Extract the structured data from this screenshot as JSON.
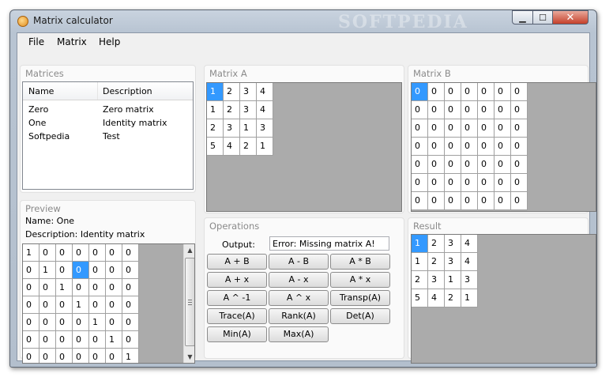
{
  "window": {
    "title": "Matrix calculator",
    "watermark": "SOFTPEDIA",
    "min_glyph": "▁",
    "max_glyph": "☐",
    "close_glyph": "✕",
    "app_icon": "calculator-icon"
  },
  "menu": {
    "items": [
      {
        "label": "File"
      },
      {
        "label": "Matrix"
      },
      {
        "label": "Help"
      }
    ]
  },
  "matrices_panel": {
    "title": "Matrices",
    "columns": [
      "Name",
      "Description"
    ],
    "rows": [
      {
        "name": "Zero",
        "description": "Zero matrix"
      },
      {
        "name": "One",
        "description": "Identity matrix"
      },
      {
        "name": "Softpedia",
        "description": "Test"
      }
    ]
  },
  "preview_panel": {
    "title": "Preview",
    "name_line": "Name: One",
    "description_line": "Description: Identity matrix",
    "grid": [
      [
        1,
        0,
        0,
        0,
        0,
        0,
        0
      ],
      [
        0,
        1,
        0,
        0,
        0,
        0,
        0
      ],
      [
        0,
        0,
        1,
        0,
        0,
        0,
        0
      ],
      [
        0,
        0,
        0,
        1,
        0,
        0,
        0
      ],
      [
        0,
        0,
        0,
        0,
        1,
        0,
        0
      ],
      [
        0,
        0,
        0,
        0,
        0,
        1,
        0
      ],
      [
        0,
        0,
        0,
        0,
        0,
        0,
        1
      ]
    ],
    "selected_cell": [
      1,
      3
    ],
    "scroll_up": "▲",
    "scroll_down": "▼"
  },
  "matrix_a": {
    "title": "Matrix A",
    "grid": [
      [
        1,
        2,
        3,
        4
      ],
      [
        1,
        2,
        3,
        4
      ],
      [
        2,
        3,
        1,
        3
      ],
      [
        5,
        4,
        2,
        1
      ]
    ],
    "selected_cell": [
      0,
      0
    ]
  },
  "matrix_b": {
    "title": "Matrix B",
    "grid": [
      [
        0,
        0,
        0,
        0,
        0,
        0,
        0
      ],
      [
        0,
        0,
        0,
        0,
        0,
        0,
        0
      ],
      [
        0,
        0,
        0,
        0,
        0,
        0,
        0
      ],
      [
        0,
        0,
        0,
        0,
        0,
        0,
        0
      ],
      [
        0,
        0,
        0,
        0,
        0,
        0,
        0
      ],
      [
        0,
        0,
        0,
        0,
        0,
        0,
        0
      ],
      [
        0,
        0,
        0,
        0,
        0,
        0,
        0
      ]
    ],
    "selected_cell": [
      0,
      0
    ]
  },
  "operations": {
    "title": "Operations",
    "output_label": "Output:",
    "output_value": "Error: Missing matrix A!",
    "buttons": [
      {
        "label": "A + B",
        "name": "a-plus-b-button"
      },
      {
        "label": "A - B",
        "name": "a-minus-b-button"
      },
      {
        "label": "A * B",
        "name": "a-times-b-button"
      },
      {
        "label": "A + x",
        "name": "a-plus-x-button"
      },
      {
        "label": "A - x",
        "name": "a-minus-x-button"
      },
      {
        "label": "A * x",
        "name": "a-times-x-button"
      },
      {
        "label": "A ^ -1",
        "name": "a-inverse-button"
      },
      {
        "label": "A ^ x",
        "name": "a-power-button"
      },
      {
        "label": "Transp(A)",
        "name": "transpose-button"
      },
      {
        "label": "Trace(A)",
        "name": "trace-button"
      },
      {
        "label": "Rank(A)",
        "name": "rank-button"
      },
      {
        "label": "Det(A)",
        "name": "determinant-button"
      },
      {
        "label": "Min(A)",
        "name": "min-button"
      },
      {
        "label": "Max(A)",
        "name": "max-button"
      }
    ]
  },
  "result": {
    "title": "Result",
    "grid": [
      [
        1,
        2,
        3,
        4
      ],
      [
        1,
        2,
        3,
        4
      ],
      [
        2,
        3,
        1,
        3
      ],
      [
        5,
        4,
        2,
        1
      ]
    ],
    "selected_cell": [
      0,
      0
    ]
  }
}
